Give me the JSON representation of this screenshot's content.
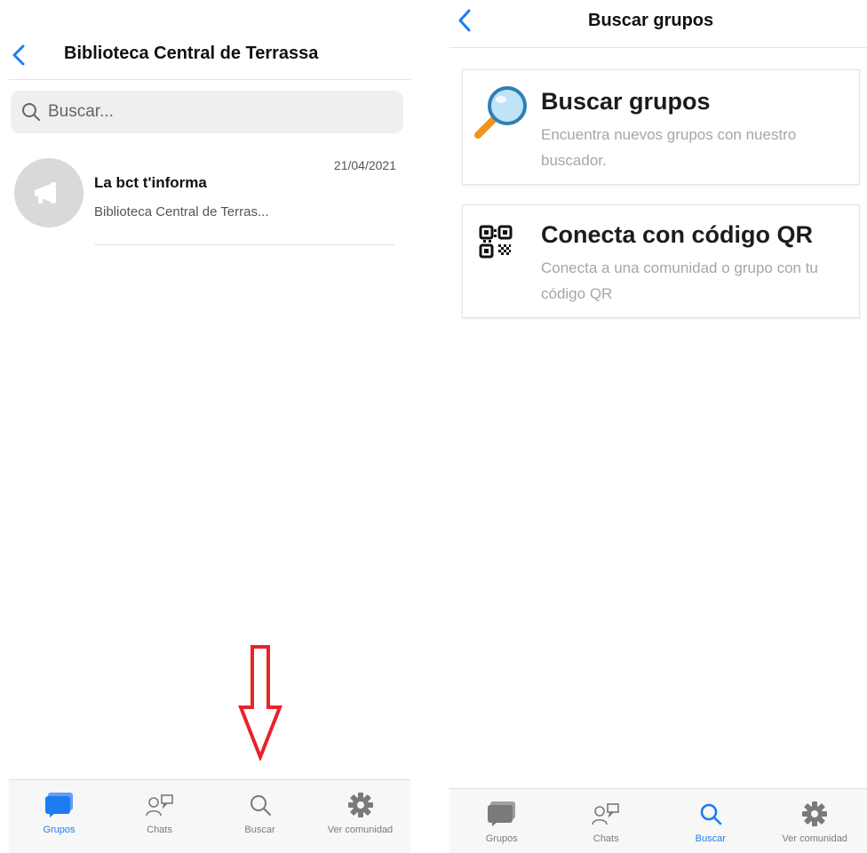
{
  "left": {
    "header": {
      "title": "Biblioteca Central de Terrassa"
    },
    "search": {
      "placeholder": "Buscar..."
    },
    "items": [
      {
        "title": "La bct t'informa",
        "subtitle": "Biblioteca Central de Terras...",
        "date": "21/04/2021"
      }
    ],
    "tabs": [
      {
        "label": "Grupos",
        "icon": "groups-icon",
        "active": true
      },
      {
        "label": "Chats",
        "icon": "chats-icon",
        "active": false
      },
      {
        "label": "Buscar",
        "icon": "search-icon",
        "active": false
      },
      {
        "label": "Ver comunidad",
        "icon": "gear-icon",
        "active": false
      }
    ]
  },
  "right": {
    "header": {
      "title": "Buscar grupos"
    },
    "cards": [
      {
        "title": "Buscar grupos",
        "description": "Encuentra nuevos grupos con nuestro buscador.",
        "icon": "magnifier-icon"
      },
      {
        "title": "Conecta con código QR",
        "description": "Conecta a una comunidad o grupo con tu código QR",
        "icon": "qr-code-icon"
      }
    ],
    "tabs": [
      {
        "label": "Grupos",
        "icon": "groups-icon",
        "active": false
      },
      {
        "label": "Chats",
        "icon": "chats-icon",
        "active": false
      },
      {
        "label": "Buscar",
        "icon": "search-icon",
        "active": true
      },
      {
        "label": "Ver comunidad",
        "icon": "gear-icon",
        "active": false
      }
    ]
  },
  "colors": {
    "accent": "#1e7cf2",
    "arrow": "#e8232a",
    "inactive": "#7a7a7a"
  }
}
